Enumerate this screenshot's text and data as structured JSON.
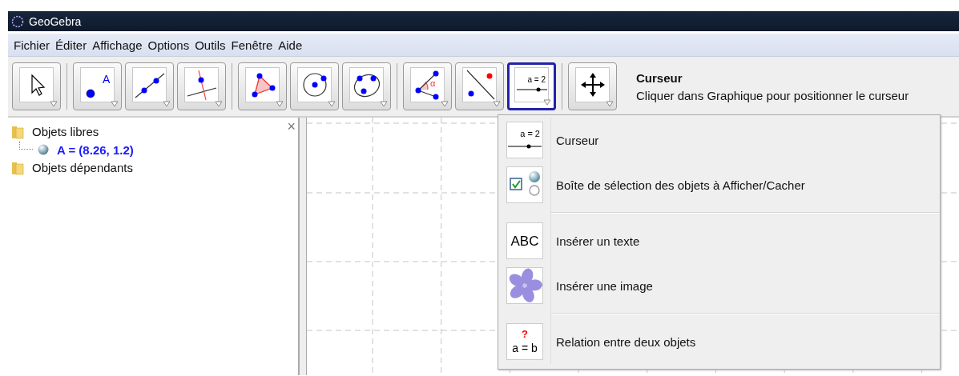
{
  "window": {
    "title": "GeoGebra"
  },
  "menu": [
    "Fichier",
    "Éditer",
    "Affichage",
    "Options",
    "Outils",
    "Fenêtre",
    "Aide"
  ],
  "toolbar": {
    "groups": [
      [
        {
          "kind": "move",
          "selected": false
        }
      ],
      [
        {
          "kind": "point",
          "selected": false,
          "glyph": "A"
        },
        {
          "kind": "line",
          "selected": false
        },
        {
          "kind": "perpendicular",
          "selected": false
        }
      ],
      [
        {
          "kind": "polygon",
          "selected": false
        },
        {
          "kind": "circle",
          "selected": false
        },
        {
          "kind": "conic",
          "selected": false
        }
      ],
      [
        {
          "kind": "angle",
          "selected": false,
          "glyph": "α"
        },
        {
          "kind": "reflect",
          "selected": false
        },
        {
          "kind": "slider",
          "selected": true,
          "glyph": "a = 2"
        }
      ],
      [
        {
          "kind": "move-view",
          "selected": false
        }
      ]
    ]
  },
  "tool_help": {
    "title": "Curseur",
    "text": "Cliquer dans Graphique pour positionner le curseur"
  },
  "algebra": {
    "close": "×",
    "tree": [
      {
        "label": "Objets libres",
        "children": [
          {
            "label": "A = (8.26, 1.2)"
          }
        ]
      },
      {
        "label": "Objets dépendants"
      }
    ]
  },
  "dropdown": {
    "groups": [
      [
        {
          "kind": "slider",
          "label": "Curseur",
          "glyph": "a = 2"
        },
        {
          "kind": "checkbox",
          "label": "Boîte de sélection des objets à Afficher/Cacher"
        }
      ],
      [
        {
          "kind": "text",
          "label": "Insérer un texte",
          "glyph": "ABC"
        },
        {
          "kind": "image",
          "label": "Insérer une image"
        }
      ],
      [
        {
          "kind": "relation",
          "label": "Relation entre deux objets",
          "glyph": "?",
          "glyph2": "a = b"
        }
      ]
    ]
  }
}
